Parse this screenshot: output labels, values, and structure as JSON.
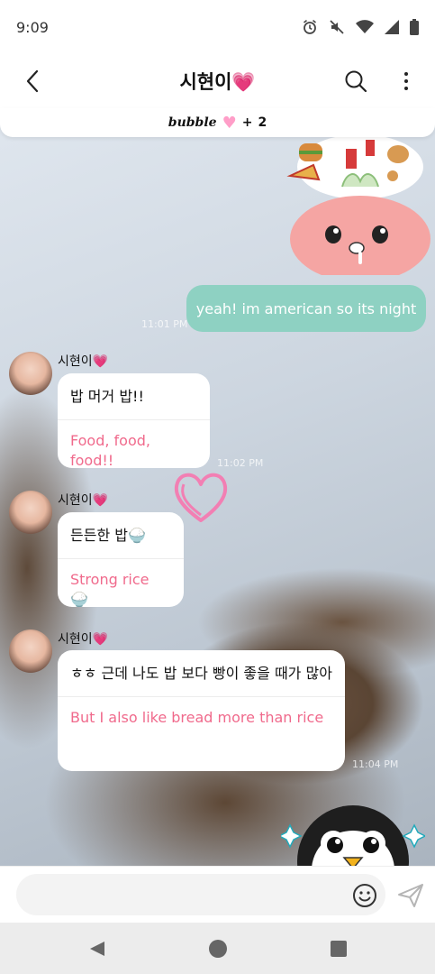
{
  "status_bar": {
    "time": "9:09",
    "icons": [
      "alarm-icon",
      "mute-icon",
      "wifi-icon",
      "signal-icon",
      "battery-icon"
    ]
  },
  "header": {
    "title": "시현이💗",
    "back_icon": "chevron-left-icon",
    "search_icon": "search-icon",
    "more_icon": "more-vertical-icon"
  },
  "subheader": {
    "logo": "bubble",
    "plus": "+",
    "count": "2"
  },
  "messages": {
    "sent_1": {
      "text": "yeah! im american so its night",
      "time": "11:01 PM"
    },
    "recv_1": {
      "sender": "시현이💗",
      "ko": "밥 머거 밥!!",
      "en": "Food, food, food!!",
      "time": "11:02 PM"
    },
    "recv_2": {
      "sender": "시현이💗",
      "ko": "든든한 밥🍚",
      "en": "Strong rice 🍚"
    },
    "recv_3": {
      "sender": "시현이💗",
      "ko": "ㅎㅎ 근데 나도 밥 보다 빵이 좋을 때가 많아",
      "en": "But I also like bread more than rice",
      "time": "11:04 PM"
    }
  },
  "input": {
    "placeholder": "",
    "emoji_icon": "smiley-icon",
    "send_icon": "send-icon"
  },
  "nav": {
    "back_icon": "triangle-back-icon",
    "home_icon": "circle-home-icon",
    "recents_icon": "square-recents-icon"
  },
  "colors": {
    "sent_bubble": "#8ed1c2",
    "translation_text": "#f06a8c",
    "heart": "#ff9ec8"
  }
}
